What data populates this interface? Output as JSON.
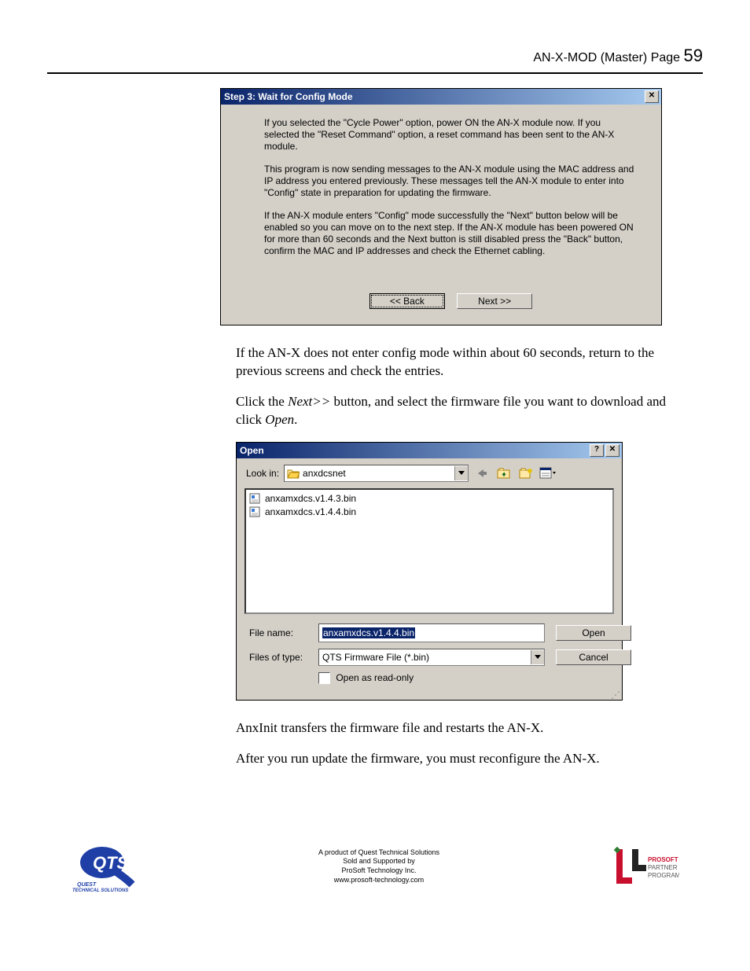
{
  "header": {
    "doc": "AN-X-MOD (Master) Page ",
    "page": "59"
  },
  "dialog1": {
    "title": "Step 3: Wait for Config Mode",
    "p1": "If you selected the \"Cycle Power\" option, power ON the AN-X module now.\nIf you selected the \"Reset Command\" option, a reset command has been sent to the AN-X module.",
    "p2": "This program is now sending messages to the AN-X module using the MAC address and IP address you entered previously. These messages tell the AN-X module to enter into \"Config\" state in preparation for updating the firmware.",
    "p3": "If the AN-X module enters \"Config\" mode successfully the \"Next\" button below will be enabled so you can move on to the next step.\nIf the AN-X module has been powered ON for more than 60 seconds and the Next button is still disabled press the \"Back\" button, confirm the MAC and IP addresses and check the Ethernet cabling.",
    "back": "<< Back",
    "next": "Next >>"
  },
  "body": {
    "p1a": "If the AN-X does not enter config mode within about 60 seconds, return to the previous screens and check the entries.",
    "p2a_pre": "Click the ",
    "p2a_i1": "Next>>",
    "p2a_mid": " button, and select the firmware file you want to download and click ",
    "p2a_i2": "Open",
    "p2a_post": ".",
    "p3a": "AnxInit transfers the firmware file and restarts the AN-X.",
    "p4a": "After you run update the firmware, you must reconfigure the AN-X."
  },
  "opendlg": {
    "title": "Open",
    "lookin_label": "Look in:",
    "lookin_value": "anxdcsnet",
    "files": [
      "anxamxdcs.v1.4.3.bin",
      "anxamxdcs.v1.4.4.bin"
    ],
    "filename_label": "File name:",
    "filename_value": "anxamxdcs.v1.4.4.bin",
    "filetype_label": "Files of type:",
    "filetype_value": "QTS Firmware File (*.bin)",
    "readonly_label": "Open as read-only",
    "open_btn": "Open",
    "cancel_btn": "Cancel"
  },
  "footer": {
    "l1": "A product of Quest Technical Solutions",
    "l2": "Sold and Supported by",
    "l3": "ProSoft Technology Inc.",
    "l4": "www.prosoft-technology.com"
  }
}
